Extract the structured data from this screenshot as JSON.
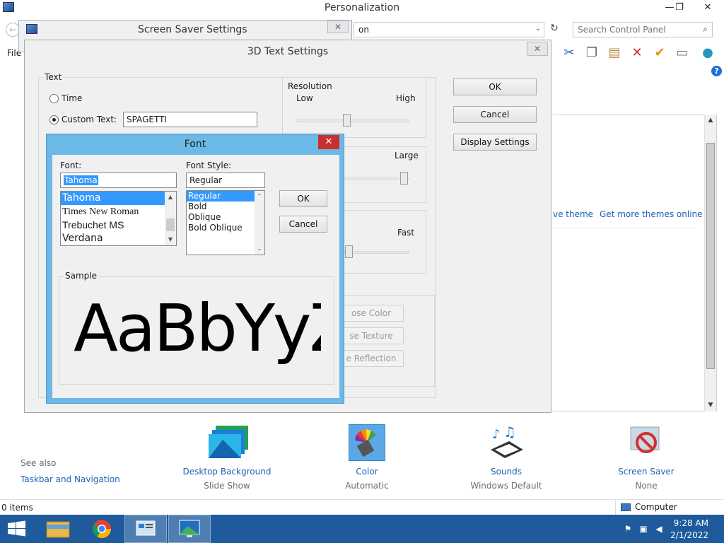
{
  "main_window": {
    "title": "Personalization",
    "minimize": "—",
    "restore": "❐",
    "close": "✕",
    "address": "on",
    "search_placeholder": "Search Control Panel",
    "menu_file": "File"
  },
  "themes": {
    "save_theme": "ve theme",
    "more_themes": "Get more themes online"
  },
  "see_also": {
    "heading": "See also",
    "link": "Taskbar and Navigation"
  },
  "control_items": [
    {
      "label": "Desktop Background",
      "sub": "Slide Show"
    },
    {
      "label": "Color",
      "sub": "Automatic"
    },
    {
      "label": "Sounds",
      "sub": "Windows Default"
    },
    {
      "label": "Screen Saver",
      "sub": "None"
    }
  ],
  "status": {
    "items": "0 items",
    "computer": "Computer"
  },
  "taskbar": {
    "time": "9:28 AM",
    "date": "2/1/2022"
  },
  "screen_saver_dialog": {
    "title": "Screen Saver Settings"
  },
  "text3d_dialog": {
    "title": "3D Text Settings",
    "text_group": "Text",
    "time_label": "Time",
    "custom_label": "Custom Text:",
    "custom_value": "SPAGETTI",
    "resolution_group": "Resolution",
    "low": "Low",
    "high": "High",
    "large": "Large",
    "fast": "Fast",
    "ok": "OK",
    "cancel": "Cancel",
    "display_settings": "Display Settings",
    "choose_color": "ose Color",
    "choose_texture": "se Texture",
    "reflection": "e Reflection"
  },
  "font_dialog": {
    "title": "Font",
    "close": "✕",
    "font_label": "Font:",
    "font_value": "Tahoma",
    "fonts": [
      "Tahoma",
      "Times New Roman",
      "Trebuchet MS",
      "Verdana"
    ],
    "style_label": "Font Style:",
    "style_value": "Regular",
    "styles": [
      "Regular",
      "Bold",
      "Oblique",
      "Bold Oblique"
    ],
    "ok": "OK",
    "cancel": "Cancel",
    "sample_label": "Sample",
    "sample_text": "AaBbYyZz"
  }
}
